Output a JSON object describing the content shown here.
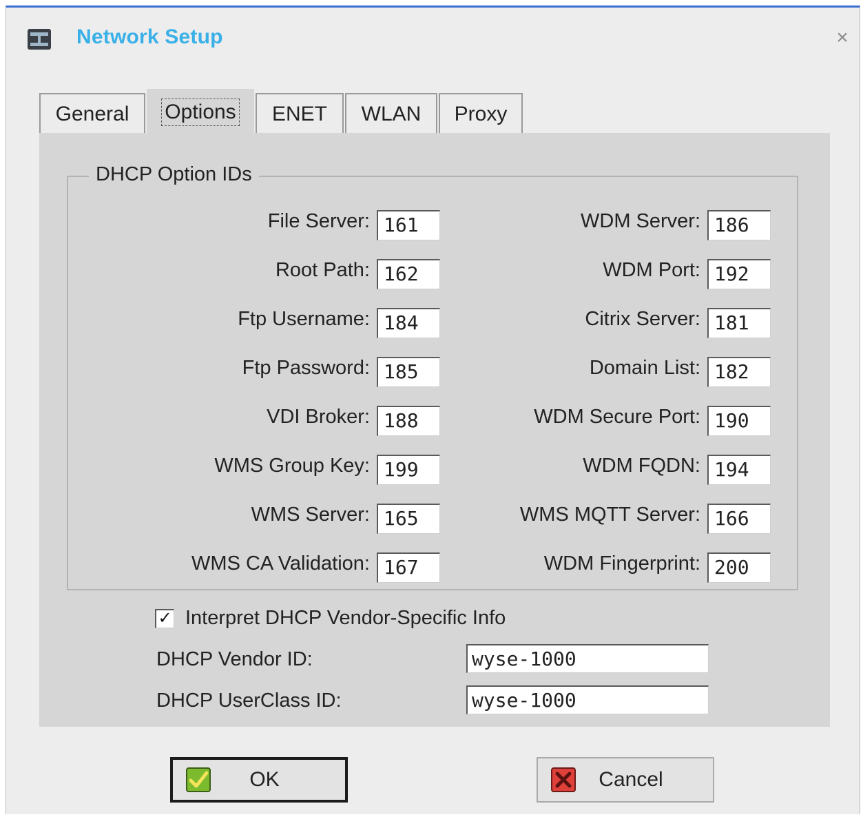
{
  "window": {
    "title": "Network Setup",
    "close_symbol": "×",
    "app_icon": "network-icon",
    "close_icon": "close-icon"
  },
  "tabs": [
    {
      "label": "General",
      "active": false
    },
    {
      "label": "Options",
      "active": true
    },
    {
      "label": "ENET",
      "active": false
    },
    {
      "label": "WLAN",
      "active": false
    },
    {
      "label": "Proxy",
      "active": false
    }
  ],
  "dhcp_group": {
    "legend": "DHCP Option IDs",
    "left_fields": [
      {
        "label": "File Server:",
        "value": "161"
      },
      {
        "label": "Root Path:",
        "value": "162"
      },
      {
        "label": "Ftp Username:",
        "value": "184"
      },
      {
        "label": "Ftp Password:",
        "value": "185"
      },
      {
        "label": "VDI Broker:",
        "value": "188"
      },
      {
        "label": "WMS Group Key:",
        "value": "199"
      },
      {
        "label": "WMS Server:",
        "value": "165"
      },
      {
        "label": "WMS CA Validation:",
        "value": "167"
      }
    ],
    "right_fields": [
      {
        "label": "WDM Server:",
        "value": "186"
      },
      {
        "label": "WDM Port:",
        "value": "192"
      },
      {
        "label": "Citrix Server:",
        "value": "181"
      },
      {
        "label": "Domain List:",
        "value": "182"
      },
      {
        "label": "WDM Secure Port:",
        "value": "190"
      },
      {
        "label": "WDM FQDN:",
        "value": "194"
      },
      {
        "label": "WMS MQTT Server:",
        "value": "166"
      },
      {
        "label": "WDM Fingerprint:",
        "value": "200"
      }
    ]
  },
  "vendor_specific": {
    "checkbox_label": "Interpret DHCP Vendor-Specific Info",
    "checked": true,
    "check_mark": "✓"
  },
  "vendor_id": {
    "label": "DHCP Vendor ID:",
    "value": "wyse-1000"
  },
  "userclass_id": {
    "label": "DHCP UserClass ID:",
    "value": "wyse-1000"
  },
  "buttons": {
    "ok_label": "OK",
    "ok_icon": "checkmark-icon",
    "ok_icon_color": "#7dbb2e",
    "cancel_label": "Cancel",
    "cancel_icon": "x-icon",
    "cancel_icon_color": "#e0403a"
  },
  "colors": {
    "title": "#3ab0e8",
    "window_border": "#3a6fd1",
    "panel": "#d6d6d6"
  }
}
